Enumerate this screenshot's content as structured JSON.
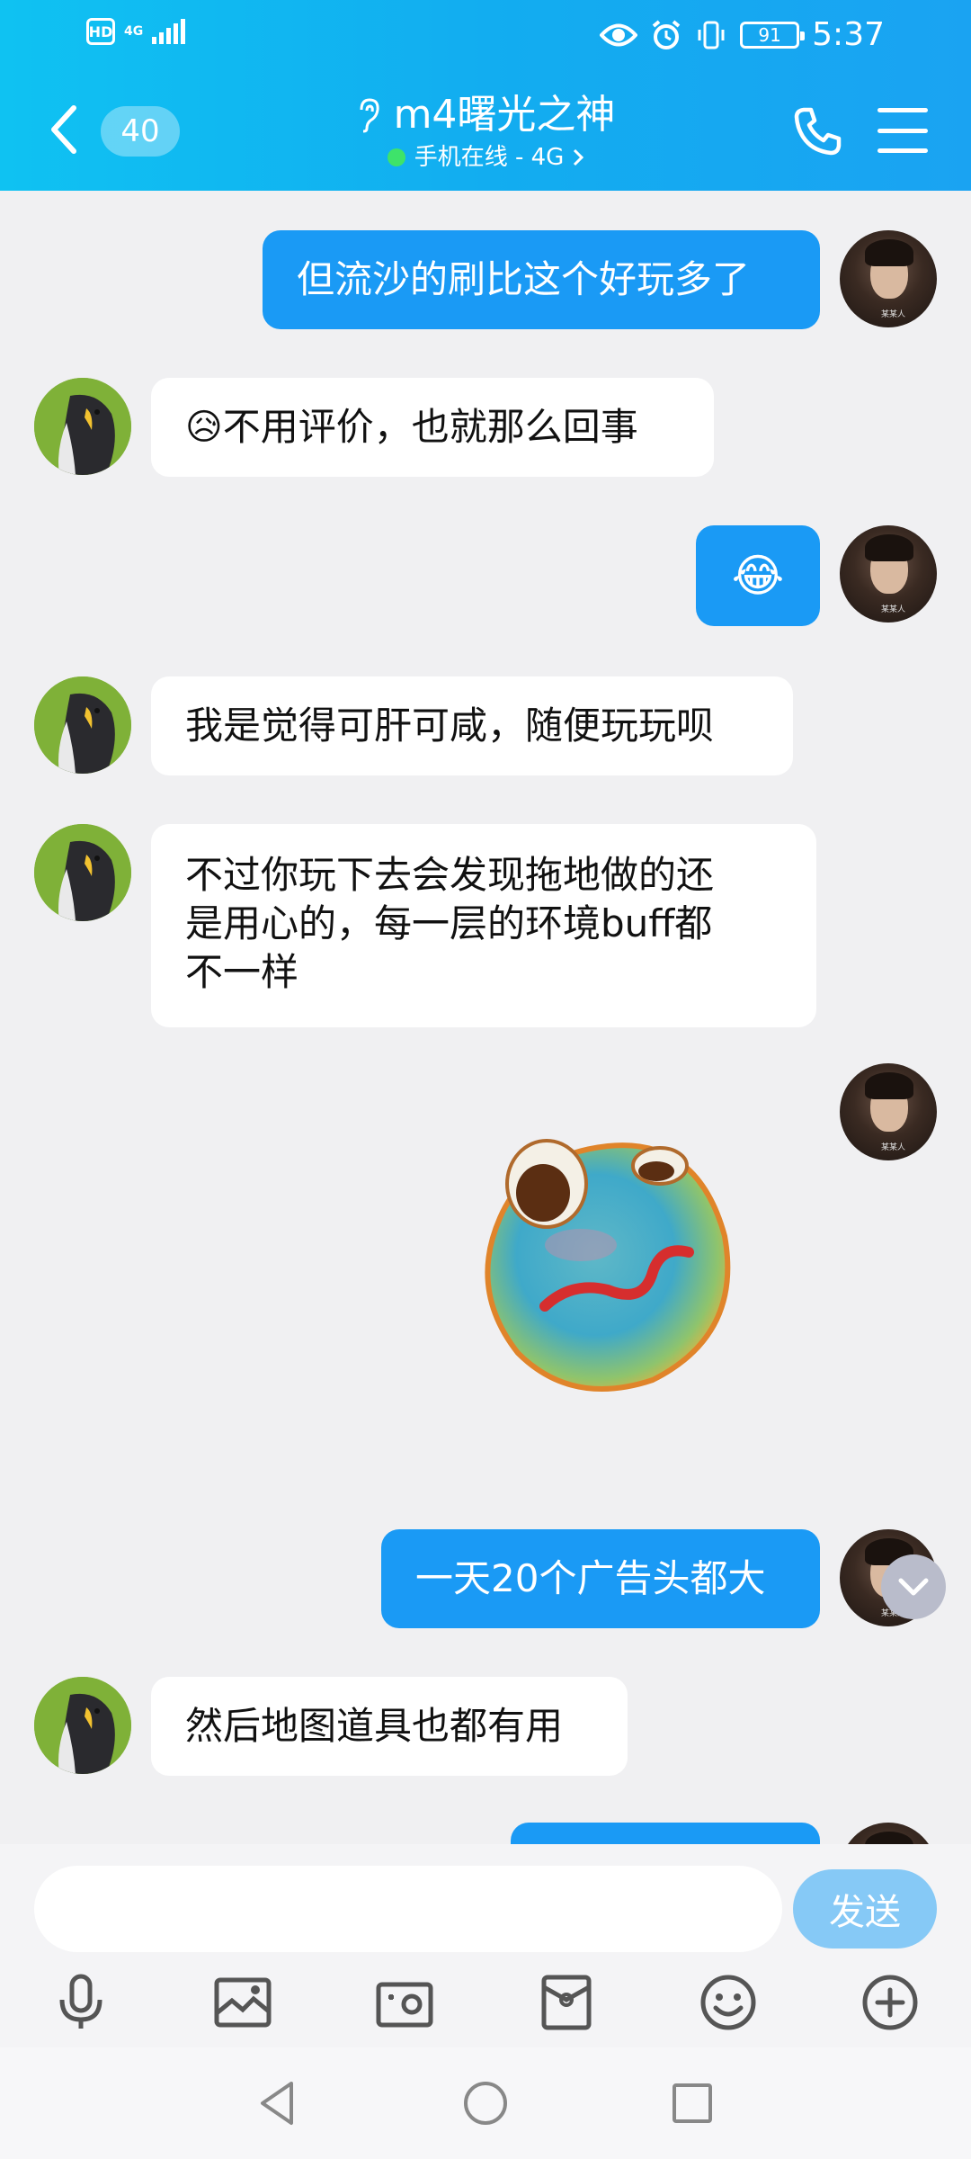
{
  "status_bar": {
    "hd_badge": "HD",
    "network": "4G",
    "battery": "91",
    "time": "5:37"
  },
  "header": {
    "unread_count": "40",
    "contact_name": "m4曙光之神",
    "status_text": "手机在线 - 4G",
    "icons": [
      "back-chevron-icon",
      "ear-icon",
      "phone-icon",
      "menu-icon"
    ],
    "accent_color": "#12adf0"
  },
  "messages": [
    {
      "from": "me",
      "text": "但流沙的刷比这个好玩多了"
    },
    {
      "from": "peer",
      "text": "不用评价，也就那么回事",
      "prefix_emoji": "😥"
    },
    {
      "from": "me",
      "text": "😂"
    },
    {
      "from": "peer",
      "text": "我是觉得可肝可咸，随便玩玩呗"
    },
    {
      "from": "peer",
      "lines": [
        "不过你玩下去会发现拖地做的还",
        "是用心的，每一层的环境buff都",
        "不一样"
      ]
    },
    {
      "from": "me",
      "sticker": "derp-face-sticker"
    },
    {
      "from": "me",
      "text": "一天20个广告头都大"
    },
    {
      "from": "peer",
      "text": "然后地图道具也都有用"
    }
  ],
  "input": {
    "value": "",
    "send_label": "发送",
    "tools": [
      "microphone-icon",
      "image-icon",
      "camera-icon",
      "red-packet-icon",
      "emoji-icon",
      "plus-icon"
    ]
  },
  "nav": {
    "buttons": [
      "back-triangle-icon",
      "home-circle-icon",
      "recents-square-icon"
    ]
  },
  "colors": {
    "outgoing_bubble": "#1a9af5",
    "incoming_bubble": "#ffffff",
    "chat_background": "#f0f0f2",
    "send_button": "#86c9f6"
  }
}
